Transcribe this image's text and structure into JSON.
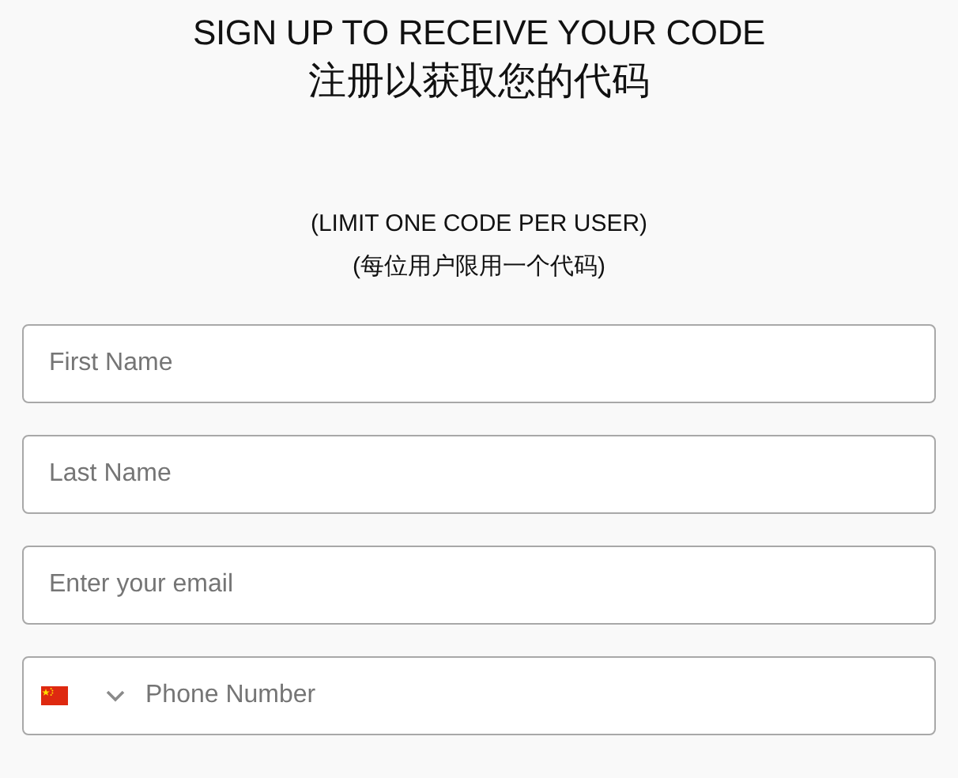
{
  "heading": {
    "title": "SIGN UP TO RECEIVE YOUR CODE",
    "title_zh": "注册以获取您的代码"
  },
  "notice": {
    "text": "(LIMIT ONE CODE PER USER)",
    "text_zh": "(每位用户限用一个代码)"
  },
  "fields": [
    {
      "kind": "text",
      "placeholder": "First Name"
    },
    {
      "kind": "text",
      "placeholder": "Last Name"
    },
    {
      "kind": "email",
      "placeholder": "Enter your email"
    },
    {
      "kind": "phone",
      "placeholder": "Phone Number"
    }
  ]
}
